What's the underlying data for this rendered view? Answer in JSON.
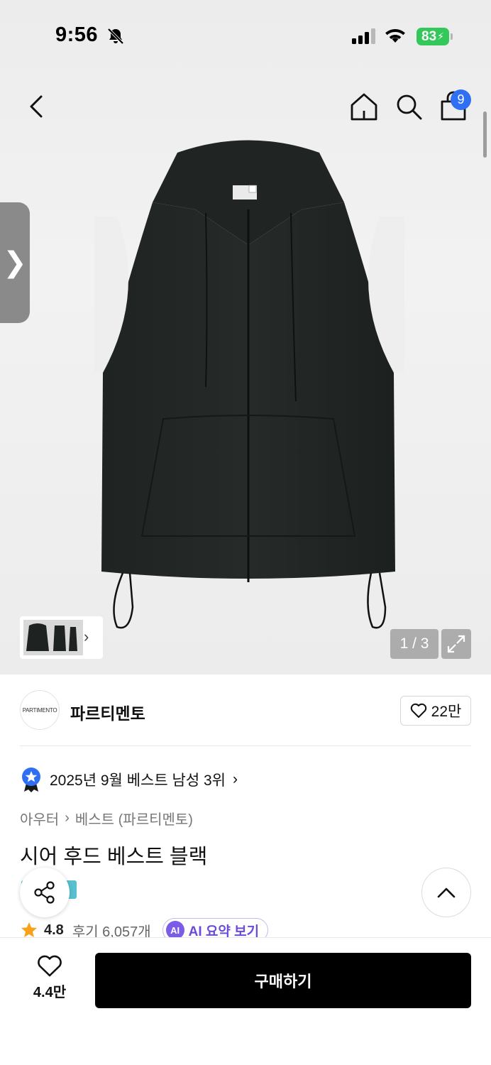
{
  "status_bar": {
    "time": "9:56",
    "battery": "83",
    "battery_color": "#34c759"
  },
  "nav": {
    "icons": [
      "chevron-left-icon",
      "home-icon",
      "search-icon",
      "shopping-bag-icon"
    ],
    "cart_badge": "9",
    "badge_color": "#2f6ff3"
  },
  "gallery": {
    "counter": "1 / 3",
    "side_tab_glyph": "❯",
    "thumb_chevron": "›"
  },
  "brand": {
    "logo_text": "PARTIMENTO",
    "name": "파르티멘토",
    "likes": "22만"
  },
  "ranking": {
    "text": "2025년 9월 베스트 남성 3위",
    "chevron": "›"
  },
  "breadcrumb": {
    "category": "아우터",
    "separator": "›",
    "subcategory": "베스트 (파르티멘토)"
  },
  "product": {
    "title": "시어 후드 베스트 블랙"
  },
  "reviews": {
    "rating": "4.8",
    "count": "후기 6,057개",
    "ai_badge": "AI",
    "ai_label": "AI 요약 보기"
  },
  "bottom_bar": {
    "wish_count": "4.4만",
    "buy_label": "구매하기",
    "buy_color": "#000000"
  }
}
